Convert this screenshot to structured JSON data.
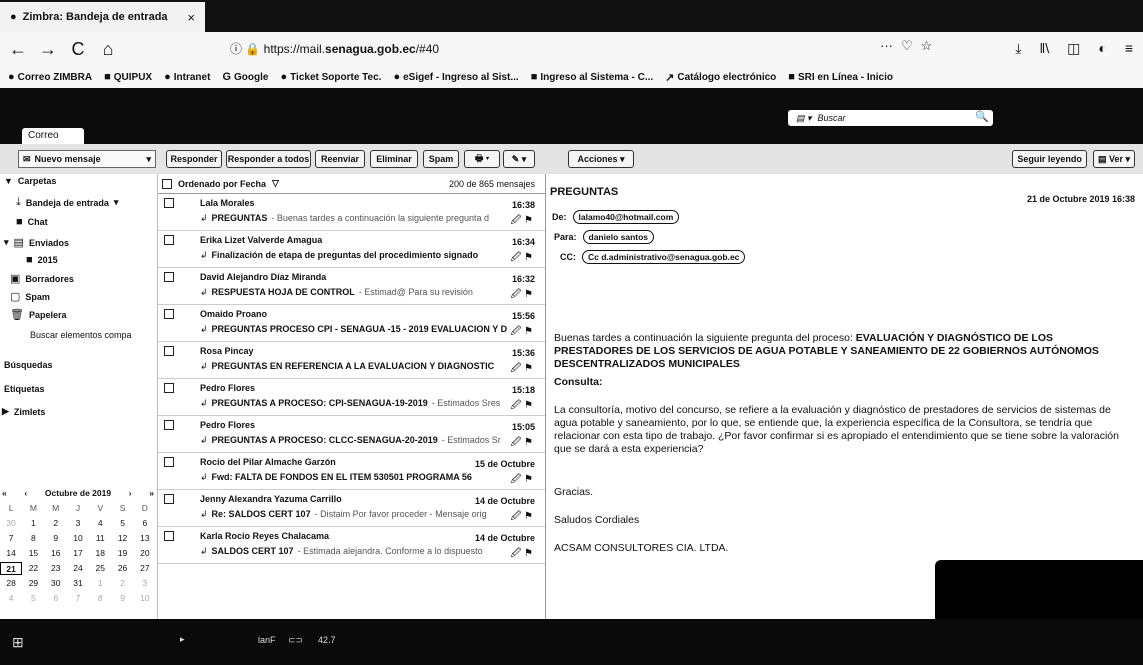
{
  "browser": {
    "tab_title": "Zimbra: Bandeja de entrada",
    "tab_close": "×",
    "url_prefix": "https://mail.",
    "url_domain": "senagua.gob.ec",
    "url_suffix": "/#40",
    "nav": {
      "back": "←",
      "forward": "→",
      "reload": "C",
      "home": "⌂"
    },
    "page_actions": {
      "more": "···",
      "pocket": "♡",
      "star": "☆"
    },
    "toolbar_icons": [
      "download-icon",
      "library-icon",
      "sidebar-icon",
      "extension-icon",
      "menu-icon"
    ],
    "bookmarks": [
      {
        "icon": "●",
        "label": "Correo ZIMBRA"
      },
      {
        "icon": "■",
        "label": "QUIPUX"
      },
      {
        "icon": "●",
        "label": "Intranet"
      },
      {
        "icon": "G",
        "label": "Google"
      },
      {
        "icon": "●",
        "label": "Ticket Soporte Tec."
      },
      {
        "icon": "●",
        "label": "eSigef - Ingreso al Sist..."
      },
      {
        "icon": "■",
        "label": "Ingreso al Sistema - C..."
      },
      {
        "icon": "↗",
        "label": "Catálogo electrónico"
      },
      {
        "icon": "■",
        "label": "SRI en Línea - Inicio"
      }
    ]
  },
  "zimbra": {
    "search_placeholder": "Buscar",
    "app_tab": "Correo",
    "new_message": "Nuevo mensaje",
    "toolbar": {
      "reply": "Responder",
      "reply_all": "Responder a todos",
      "forward": "Reenviar",
      "delete": "Eliminar",
      "spam": "Spam",
      "actions": "Acciones",
      "reading_pane": "Seguir leyendo",
      "view": "Ver"
    },
    "folders": {
      "section": "Carpetas",
      "items": [
        {
          "label": "Bandeja de entrada",
          "icon": "⤓"
        },
        {
          "label": "Chat",
          "icon": "■"
        },
        {
          "label": "Enviados",
          "icon": "▸"
        },
        {
          "label": "2015",
          "icon": "■"
        },
        {
          "label": "Borradores",
          "icon": "▣"
        },
        {
          "label": "Spam",
          "icon": "▢"
        },
        {
          "label": "Papelera",
          "icon": "🗑"
        }
      ],
      "shared_search": "Buscar elementos compa",
      "searches": "Búsquedas",
      "tags": "Etiquetas",
      "zimlets": "Zimlets"
    },
    "calendar": {
      "month": "Octubre de 2019",
      "dow": [
        "L",
        "M",
        "M",
        "J",
        "V",
        "S",
        "D"
      ],
      "weeks": [
        [
          "30",
          "1",
          "2",
          "3",
          "4",
          "5",
          "6"
        ],
        [
          "7",
          "8",
          "9",
          "10",
          "11",
          "12",
          "13"
        ],
        [
          "14",
          "15",
          "16",
          "17",
          "18",
          "19",
          "20"
        ],
        [
          "21",
          "22",
          "23",
          "24",
          "25",
          "26",
          "27"
        ],
        [
          "28",
          "29",
          "30",
          "31",
          "1",
          "2",
          "3"
        ],
        [
          "4",
          "5",
          "6",
          "7",
          "8",
          "9",
          "10"
        ]
      ],
      "today": "21"
    },
    "list": {
      "sort": "Ordenado por Fecha",
      "count": "200 de 865 mensajes",
      "messages": [
        {
          "from": "Lala Morales",
          "time": "16:38",
          "subject": "PREGUNTAS",
          "preview": "- Buenas tardes a continuación la siguiente pregunta d"
        },
        {
          "from": "Erika Lizet Valverde Amagua",
          "time": "16:34",
          "subject": "Finalización de etapa de preguntas del procedimiento signado",
          "preview": ""
        },
        {
          "from": "David Alejandro Díaz Miranda",
          "time": "16:32",
          "subject": "RESPUESTA HOJA DE CONTROL",
          "preview": "- Estimad@ Para su revisión"
        },
        {
          "from": "Omaido Proano",
          "time": "15:56",
          "subject": "PREGUNTAS PROCESO CPI - SENAGUA -15 - 2019 EVALUACION Y D",
          "preview": ""
        },
        {
          "from": "Rosa Pincay",
          "time": "15:36",
          "subject": "PREGUNTAS EN REFERENCIA A LA EVALUACION Y DIAGNOSTIC",
          "preview": ""
        },
        {
          "from": "Pedro Flores",
          "time": "15:18",
          "subject": "PREGUNTAS A PROCESO: CPI-SENAGUA-19-2019",
          "preview": "- Estimados Sres"
        },
        {
          "from": "Pedro Flores",
          "time": "15:05",
          "subject": "PREGUNTAS A PROCESO: CLCC-SENAGUA-20-2019",
          "preview": "- Estimados Sr"
        },
        {
          "from": "Rocío del Pilar Almache Garzón",
          "time": "15 de Octubre",
          "subject": "Fwd: FALTA DE FONDOS EN EL ITEM 530501 PROGRAMA 56",
          "preview": ""
        },
        {
          "from": "Jenny Alexandra Yazuma Carrillo",
          "time": "14 de Octubre",
          "subject": "Re: SALDOS CERT 107",
          "preview": "- Distaim Por favor proceder - Mensaje orig"
        },
        {
          "from": "Karla Rocío Reyes Chalacama",
          "time": "14 de Octubre",
          "subject": "SALDOS CERT 107",
          "preview": "- Estimada alejandra. Conforme a lo dispuesto"
        }
      ]
    },
    "reading": {
      "subject": "PREGUNTAS",
      "date": "21 de Octubre 2019 16:38",
      "from_label": "De:",
      "from": "lalamo40@hotmail.com",
      "to_label": "Para:",
      "to": "danielo santos",
      "cc_label": "CC:",
      "cc": "Cc d.administrativo@senagua.gob.ec",
      "intro": "Buenas tardes a continuación la siguiente pregunta del proceso:",
      "process": "EVALUACIÓN Y DIAGNÓSTICO DE LOS PRESTADORES DE LOS SERVICIOS DE AGUA POTABLE Y SANEAMIENTO DE 22 GOBIERNOS AUTÓNOMOS DESCENTRALIZADOS MUNICIPALES",
      "heading": "Consulta:",
      "question": "La consultoría, motivo del concurso, se refiere a la evaluación y diagnóstico de prestadores de servicios de sistemas de agua potable y saneamiento, por lo que, se entiende que, la experiencia específica de la Consultora, se tendría que relacionar con esta tipo de trabajo. ¿Por favor confirmar si es apropiado el entendimiento que se tiene sobre la valoración que se dará a esta experiencia?",
      "thanks": "Gracias.",
      "regards": "Saludos Cordiales",
      "signature": "ACSAM CONSULTORES CIA. LTDA."
    }
  },
  "taskbar": {
    "start": "⊞",
    "items": [
      "▸",
      "lanF",
      "⊂⊃",
      "42.7"
    ]
  }
}
